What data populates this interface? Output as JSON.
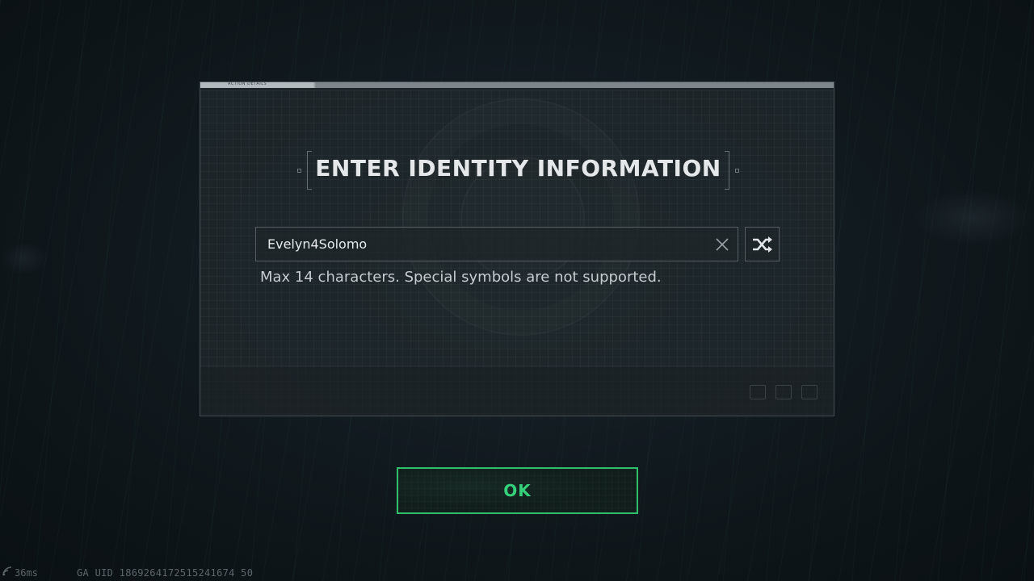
{
  "dialog": {
    "tab_label": "ACTION DETAILS",
    "title": "ENTER IDENTITY INFORMATION",
    "name_input": {
      "value": "Evelyn4Solomo"
    },
    "hint": "Max 14 characters. Special symbols are not supported."
  },
  "ok_button": {
    "label": "OK"
  },
  "footer": {
    "ping": "36ms",
    "uid": "GA UID 1869264172515241674 50"
  },
  "icons": {
    "clear": "close-icon",
    "randomize": "shuffle-icon",
    "network": "wifi-icon"
  },
  "colors": {
    "accent_green": "#34d07a",
    "title_text": "#e4e8ea"
  }
}
